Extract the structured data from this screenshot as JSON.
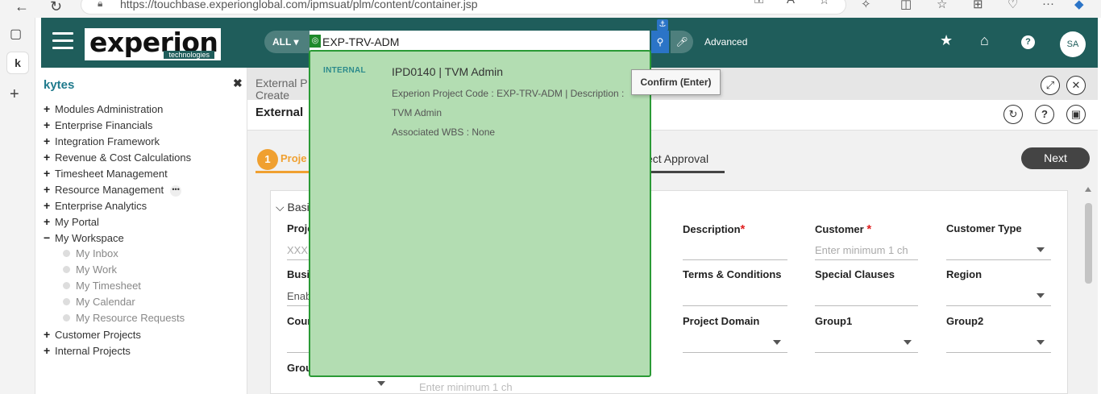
{
  "browser": {
    "url": "https://touchbase.experionglobal.com/ipmsuat/plm/content/container.jsp"
  },
  "header": {
    "logo_text": "experion",
    "logo_sub": "technologies",
    "search_scope": "ALL",
    "search_value": "EXP-TRV-ADM",
    "advanced_label": "Advanced",
    "avatar_initials": "SA",
    "colors": {
      "header_bg": "#1f5d5b",
      "accent": "#f0a030"
    }
  },
  "sidebar": {
    "title": "kytes",
    "items": [
      {
        "label": "Modules Administration",
        "sign": "+"
      },
      {
        "label": "Enterprise Financials",
        "sign": "+"
      },
      {
        "label": "Integration Framework",
        "sign": "+"
      },
      {
        "label": "Revenue & Cost Calculations",
        "sign": "+"
      },
      {
        "label": "Timesheet Management",
        "sign": "+"
      },
      {
        "label": "Resource Management",
        "sign": "+"
      },
      {
        "label": "Enterprise Analytics",
        "sign": "+"
      },
      {
        "label": "My Portal",
        "sign": "+"
      },
      {
        "label": "My Workspace",
        "sign": "−"
      }
    ],
    "workspace_sub": [
      {
        "label": "My Inbox"
      },
      {
        "label": "My Work"
      },
      {
        "label": "My Timesheet"
      },
      {
        "label": "My Calendar"
      },
      {
        "label": "My Resource Requests"
      }
    ],
    "items_after": [
      {
        "label": "Customer Projects",
        "sign": "+"
      },
      {
        "label": "Internal Projects",
        "sign": "+"
      }
    ]
  },
  "main": {
    "breadcrumb_line1": "External P",
    "breadcrumb_line2": "Create",
    "page_title": "External",
    "step1_number": "1",
    "step1_label": "Proje",
    "step_approval": "ect Approval",
    "next_label": "Next",
    "section_label": "Basi",
    "fields": {
      "project_label": "Proje",
      "project_placeholder": "XXX",
      "description_label": "Description",
      "customer_label": "Customer",
      "customer_placeholder": "Enter minimum 1 ch",
      "customer_type_label": "Customer Type",
      "business_label": "Busi",
      "business_value": "Enab",
      "terms_label": "Terms & Conditions",
      "special_label": "Special Clauses",
      "region_label": "Region",
      "country_label": "Cour",
      "domain_label": "Project Domain",
      "group1_label": "Group1",
      "group2_label": "Group2",
      "group_label": "Grou",
      "bottom_placeholder": "Enter minimum 1 ch"
    }
  },
  "suggestion": {
    "tag": "INTERNAL",
    "title": "IPD0140 | TVM Admin",
    "line1": "Experion Project Code : EXP-TRV-ADM | Description :",
    "line2": "TVM Admin",
    "line3": "Associated WBS : None"
  },
  "tooltip": {
    "text": "Confirm (Enter)"
  }
}
